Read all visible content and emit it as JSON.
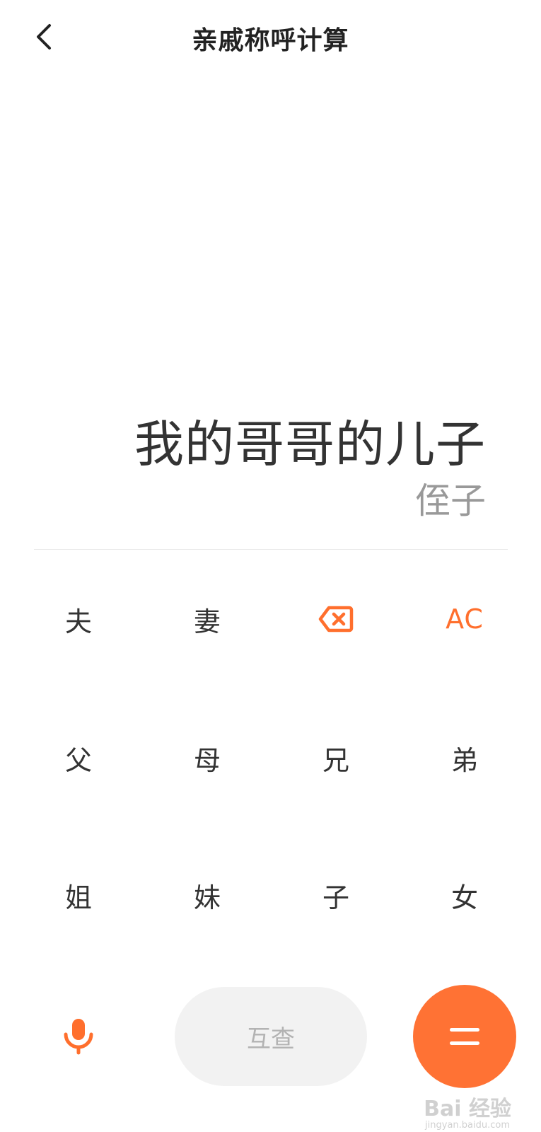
{
  "header": {
    "title": "亲戚称呼计算",
    "back_icon": "chevron-left-icon"
  },
  "display": {
    "expression": "我的哥哥的儿子",
    "result": "侄子"
  },
  "keypad": {
    "husband": "夫",
    "wife": "妻",
    "backspace_icon": "backspace-icon",
    "clear": "AC",
    "father": "父",
    "mother": "母",
    "elder_brother": "兄",
    "younger_brother": "弟",
    "elder_sister": "姐",
    "younger_sister": "妹",
    "son": "子",
    "daughter": "女"
  },
  "bottom": {
    "mic_icon": "microphone-icon",
    "mutual_label": "互查",
    "equals_icon": "equals-icon"
  },
  "watermark": {
    "text": "Bai 经验",
    "sub": "jingyan.baidu.com"
  },
  "colors": {
    "accent": "#ff7234",
    "text": "#333333",
    "muted": "#999999",
    "button_bg": "#f2f2f2"
  }
}
